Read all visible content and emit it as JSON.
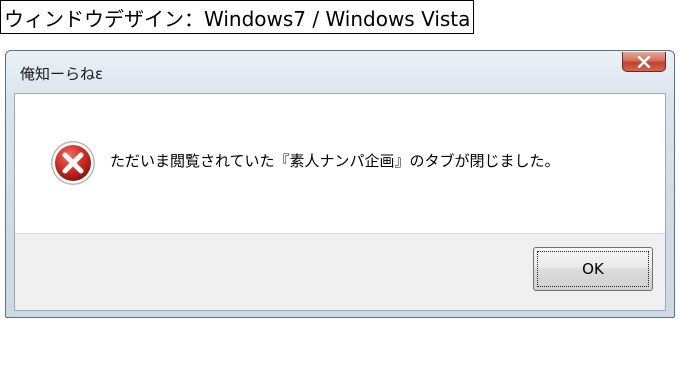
{
  "caption": "ウィンドウデザイン：Windows7 / Windows Vista",
  "window": {
    "title": "俺知ーらねε",
    "message": "ただいま閲覧されていた『素人ナンパ企画』のタブが閉じました。",
    "ok_label": "OK",
    "close_icon": "close-icon",
    "status_icon": "error-icon"
  },
  "colors": {
    "close_button": "#c8452f",
    "error_icon": "#c9211e"
  }
}
